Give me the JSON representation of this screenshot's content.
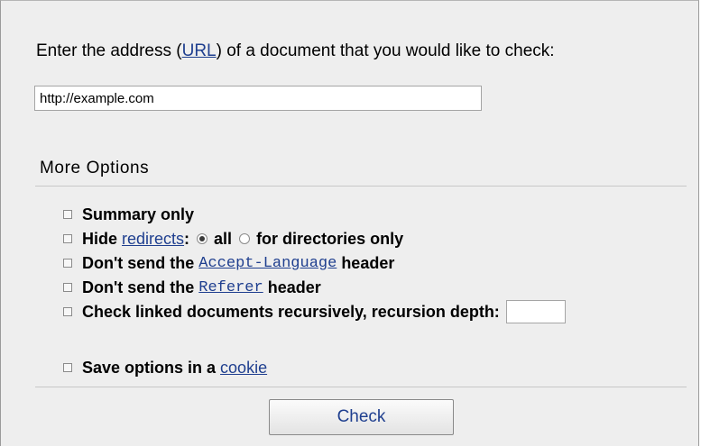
{
  "form": {
    "prompt_before": "Enter the address (",
    "prompt_link": "URL",
    "prompt_after": ") of a document that you would like to check:",
    "url_value": "http://example.com"
  },
  "options": {
    "legend": "More Options",
    "summary_only": "Summary only",
    "hide_prefix": "Hide ",
    "hide_link": "redirects",
    "hide_colon": ":",
    "radio_all": "all",
    "radio_dirs": "for directories only",
    "dont_send_prefix": "Don't send the ",
    "accept_language": "Accept-Language",
    "referer": "Referer",
    "header_suffix": " header",
    "recursive": "Check linked documents recursively, recursion depth:",
    "depth_value": "",
    "save_prefix": "Save options in a ",
    "save_link": "cookie"
  },
  "actions": {
    "check_label": "Check"
  },
  "colors": {
    "link": "#1f3f8f",
    "panel_bg": "#eeeeee"
  }
}
